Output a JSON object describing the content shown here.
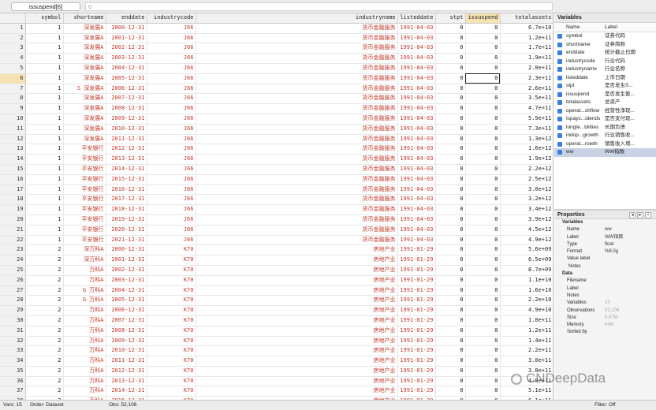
{
  "cellref": "issuspend[6]",
  "cellvalue": "0",
  "columns": [
    "symbol",
    "shortname",
    "enddate",
    "industrycode",
    "industryname",
    "listeddate",
    "stpt",
    "issuspend",
    "totalassets"
  ],
  "rows": [
    [
      "1",
      "1",
      "深发展A",
      "2000-12-31",
      "J66",
      "货币金融服务",
      "1991-04-03",
      "0",
      "0",
      "6.7e+10"
    ],
    [
      "2",
      "1",
      "深发展A",
      "2001-12-31",
      "J66",
      "货币金融服务",
      "1991-04-03",
      "0",
      "0",
      "1.2e+11"
    ],
    [
      "3",
      "1",
      "深发展A",
      "2002-12-31",
      "J66",
      "货币金融服务",
      "1991-04-03",
      "0",
      "0",
      "1.7e+11"
    ],
    [
      "4",
      "1",
      "深发展A",
      "2003-12-31",
      "J66",
      "货币金融服务",
      "1991-04-03",
      "0",
      "0",
      "1.9e+11"
    ],
    [
      "5",
      "1",
      "深发展A",
      "2004-12-31",
      "J66",
      "货币金融服务",
      "1991-04-03",
      "0",
      "0",
      "2.0e+11"
    ],
    [
      "6",
      "1",
      "深发展A",
      "2005-12-31",
      "J66",
      "货币金融服务",
      "1991-04-03",
      "0",
      "0",
      "2.3e+11"
    ],
    [
      "7",
      "1",
      "S 深发展A",
      "2006-12-31",
      "J66",
      "货币金融服务",
      "1991-04-03",
      "0",
      "0",
      "2.6e+11"
    ],
    [
      "8",
      "1",
      "深发展A",
      "2007-12-31",
      "J66",
      "货币金融服务",
      "1991-04-03",
      "0",
      "0",
      "3.5e+11"
    ],
    [
      "9",
      "1",
      "深发展A",
      "2008-12-31",
      "J66",
      "货币金融服务",
      "1991-04-03",
      "0",
      "0",
      "4.7e+11"
    ],
    [
      "10",
      "1",
      "深发展A",
      "2009-12-31",
      "J66",
      "货币金融服务",
      "1991-04-03",
      "0",
      "0",
      "5.9e+11"
    ],
    [
      "11",
      "1",
      "深发展A",
      "2010-12-31",
      "J66",
      "货币金融服务",
      "1991-04-03",
      "0",
      "0",
      "7.3e+11"
    ],
    [
      "12",
      "1",
      "深发展A",
      "2011-12-31",
      "J66",
      "货币金融服务",
      "1991-04-03",
      "0",
      "0",
      "1.3e+12"
    ],
    [
      "13",
      "1",
      "平安银行",
      "2012-12-31",
      "J66",
      "货币金融服务",
      "1991-04-03",
      "0",
      "0",
      "1.6e+12"
    ],
    [
      "14",
      "1",
      "平安银行",
      "2013-12-31",
      "J66",
      "货币金融服务",
      "1991-04-03",
      "0",
      "0",
      "1.9e+12"
    ],
    [
      "15",
      "1",
      "平安银行",
      "2014-12-31",
      "J66",
      "货币金融服务",
      "1991-04-03",
      "0",
      "0",
      "2.2e+12"
    ],
    [
      "16",
      "1",
      "平安银行",
      "2015-12-31",
      "J66",
      "货币金融服务",
      "1991-04-03",
      "0",
      "0",
      "2.5e+12"
    ],
    [
      "17",
      "1",
      "平安银行",
      "2016-12-31",
      "J66",
      "货币金融服务",
      "1991-04-03",
      "0",
      "0",
      "3.0e+12"
    ],
    [
      "18",
      "1",
      "平安银行",
      "2017-12-31",
      "J66",
      "货币金融服务",
      "1991-04-03",
      "0",
      "0",
      "3.2e+12"
    ],
    [
      "19",
      "1",
      "平安银行",
      "2018-12-31",
      "J66",
      "货币金融服务",
      "1991-04-03",
      "0",
      "0",
      "3.4e+12"
    ],
    [
      "20",
      "1",
      "平安银行",
      "2019-12-31",
      "J66",
      "货币金融服务",
      "1991-04-03",
      "0",
      "0",
      "3.9e+12"
    ],
    [
      "21",
      "1",
      "平安银行",
      "2020-12-31",
      "J66",
      "货币金融服务",
      "1991-04-03",
      "0",
      "0",
      "4.5e+12"
    ],
    [
      "22",
      "1",
      "平安银行",
      "2021-12-31",
      "J66",
      "货币金融服务",
      "1991-04-03",
      "0",
      "0",
      "4.9e+12"
    ],
    [
      "23",
      "2",
      "深万科A",
      "2000-12-31",
      "K70",
      "房地产业",
      "1991-01-29",
      "0",
      "0",
      "5.6e+09"
    ],
    [
      "24",
      "2",
      "深万科A",
      "2001-12-31",
      "K70",
      "房地产业",
      "1991-01-29",
      "0",
      "0",
      "6.5e+09"
    ],
    [
      "25",
      "2",
      "万科A",
      "2002-12-31",
      "K70",
      "房地产业",
      "1991-01-29",
      "0",
      "0",
      "8.7e+09"
    ],
    [
      "26",
      "2",
      "万科A",
      "2003-12-31",
      "K70",
      "房地产业",
      "1991-01-29",
      "0",
      "0",
      "1.1e+10"
    ],
    [
      "27",
      "2",
      "G 万科A",
      "2004-12-31",
      "K70",
      "房地产业",
      "1991-01-29",
      "0",
      "0",
      "1.6e+10"
    ],
    [
      "28",
      "2",
      "G 万科A",
      "2005-12-31",
      "K70",
      "房地产业",
      "1991-01-29",
      "0",
      "0",
      "2.2e+10"
    ],
    [
      "29",
      "2",
      "万科A",
      "2006-12-31",
      "K70",
      "房地产业",
      "1991-01-29",
      "0",
      "0",
      "4.9e+10"
    ],
    [
      "30",
      "2",
      "万科A",
      "2007-12-31",
      "K70",
      "房地产业",
      "1991-01-29",
      "0",
      "0",
      "1.0e+11"
    ],
    [
      "31",
      "2",
      "万科A",
      "2008-12-31",
      "K70",
      "房地产业",
      "1991-01-29",
      "0",
      "0",
      "1.2e+11"
    ],
    [
      "32",
      "2",
      "万科A",
      "2009-12-31",
      "K70",
      "房地产业",
      "1991-01-29",
      "0",
      "0",
      "1.4e+11"
    ],
    [
      "33",
      "2",
      "万科A",
      "2010-12-31",
      "K70",
      "房地产业",
      "1991-01-29",
      "0",
      "0",
      "2.2e+11"
    ],
    [
      "34",
      "2",
      "万科A",
      "2011-12-31",
      "K70",
      "房地产业",
      "1991-01-29",
      "0",
      "0",
      "3.0e+11"
    ],
    [
      "35",
      "2",
      "万科A",
      "2012-12-31",
      "K70",
      "房地产业",
      "1991-01-29",
      "0",
      "0",
      "3.8e+11"
    ],
    [
      "36",
      "2",
      "万科A",
      "2013-12-31",
      "K70",
      "房地产业",
      "1991-01-29",
      "0",
      "0",
      "4.8e+11"
    ],
    [
      "37",
      "2",
      "万科A",
      "2014-12-31",
      "K70",
      "房地产业",
      "1991-01-29",
      "0",
      "0",
      "5.1e+11"
    ],
    [
      "38",
      "2",
      "万科A",
      "2015-12-31",
      "K70",
      "房地产业",
      "1991-01-29",
      "0",
      "0",
      "6.1e+11"
    ],
    [
      "39",
      "2",
      "万科A",
      "2016-12-31",
      "K70",
      "房地产业",
      "1991-01-29",
      "0",
      "0",
      "8.3e+11"
    ],
    [
      "40",
      "2",
      "万科A",
      "2017-12-31",
      "K70",
      "房地产业",
      "1991-01-29",
      "0",
      "0",
      "1.2e+12"
    ]
  ],
  "variables": {
    "title": "Variables",
    "col_name": "Name",
    "col_label": "Label",
    "items": [
      {
        "name": "symbol",
        "label": "证券代码"
      },
      {
        "name": "shortname",
        "label": "证券简称"
      },
      {
        "name": "enddate",
        "label": "统计截止日期"
      },
      {
        "name": "industrycode",
        "label": "行业代码"
      },
      {
        "name": "industryname",
        "label": "行业名称"
      },
      {
        "name": "listeddate",
        "label": "上市日期"
      },
      {
        "name": "stpt",
        "label": "是否发生S..."
      },
      {
        "name": "issuspend",
        "label": "是否发生暂..."
      },
      {
        "name": "totalassets",
        "label": "总资产"
      },
      {
        "name": "operat...shflow",
        "label": "经营性净现..."
      },
      {
        "name": "Ispayc...idends",
        "label": "是否支付现..."
      },
      {
        "name": "longte...bilities",
        "label": "长期负债"
      },
      {
        "name": "indop...growth",
        "label": "行业销售收..."
      },
      {
        "name": "operat...rowth",
        "label": "销售收入增..."
      },
      {
        "name": "ww",
        "label": "WW指数"
      }
    ]
  },
  "properties": {
    "title": "Properties",
    "variables_section": "Variables",
    "data_section": "Data",
    "var_props": [
      {
        "key": "Name",
        "value": "ww"
      },
      {
        "key": "Label",
        "value": "WW指数"
      },
      {
        "key": "Type",
        "value": "float"
      },
      {
        "key": "Format",
        "value": "%8.0g"
      },
      {
        "key": "Value label",
        "value": ""
      }
    ],
    "notes_label": "Notes",
    "data_props": [
      {
        "key": "Filename",
        "value": ""
      },
      {
        "key": "Label",
        "value": ""
      },
      {
        "key": "Notes",
        "value": ""
      },
      {
        "key": "Variables",
        "value": "15"
      },
      {
        "key": "Observations",
        "value": "52,106"
      },
      {
        "key": "Size",
        "value": "6.97M"
      },
      {
        "key": "Memory",
        "value": "64M"
      },
      {
        "key": "Sorted by",
        "value": ""
      }
    ]
  },
  "status": {
    "vars": "Vars: 15",
    "order": "Order: Dataset",
    "obs": "Obs: 52,106",
    "filter": "Filter: Off"
  },
  "watermark": "CNDeepData"
}
